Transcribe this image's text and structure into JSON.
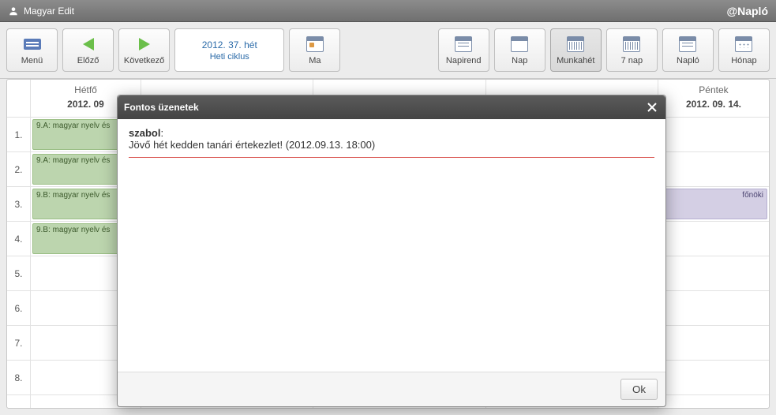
{
  "topbar": {
    "username": "Magyar Edit",
    "appname": "@Napló"
  },
  "toolbar": {
    "menu": "Menü",
    "prev": "Előző",
    "next": "Következő",
    "week_title": "2012. 37. hét",
    "week_sub": "Heti ciklus",
    "today": "Ma",
    "agenda": "Napirend",
    "day": "Nap",
    "workweek": "Munkahét",
    "sevendays": "7 nap",
    "journal": "Napló",
    "month": "Hónap"
  },
  "calendar": {
    "hours": [
      "1.",
      "2.",
      "3.",
      "4.",
      "5.",
      "6.",
      "7.",
      "8."
    ],
    "days": [
      {
        "name": "Hétfő",
        "date": "2012. 09"
      },
      {
        "name": "",
        "date": ""
      },
      {
        "name": "",
        "date": ""
      },
      {
        "name": "",
        "date": ""
      },
      {
        "name": "Péntek",
        "date": "2012. 09. 14."
      }
    ],
    "monday_lessons": [
      "9.A: magyar nyelv és",
      "9.A: magyar nyelv és",
      "9.B: magyar nyelv és",
      "9.B: magyar nyelv és"
    ],
    "friday_r3": "főnöki"
  },
  "modal": {
    "title": "Fontos üzenetek",
    "sender": "szabol",
    "body": "Jövő hét kedden tanári értekezlet! (2012.09.13. 18:00)",
    "ok": "Ok"
  }
}
